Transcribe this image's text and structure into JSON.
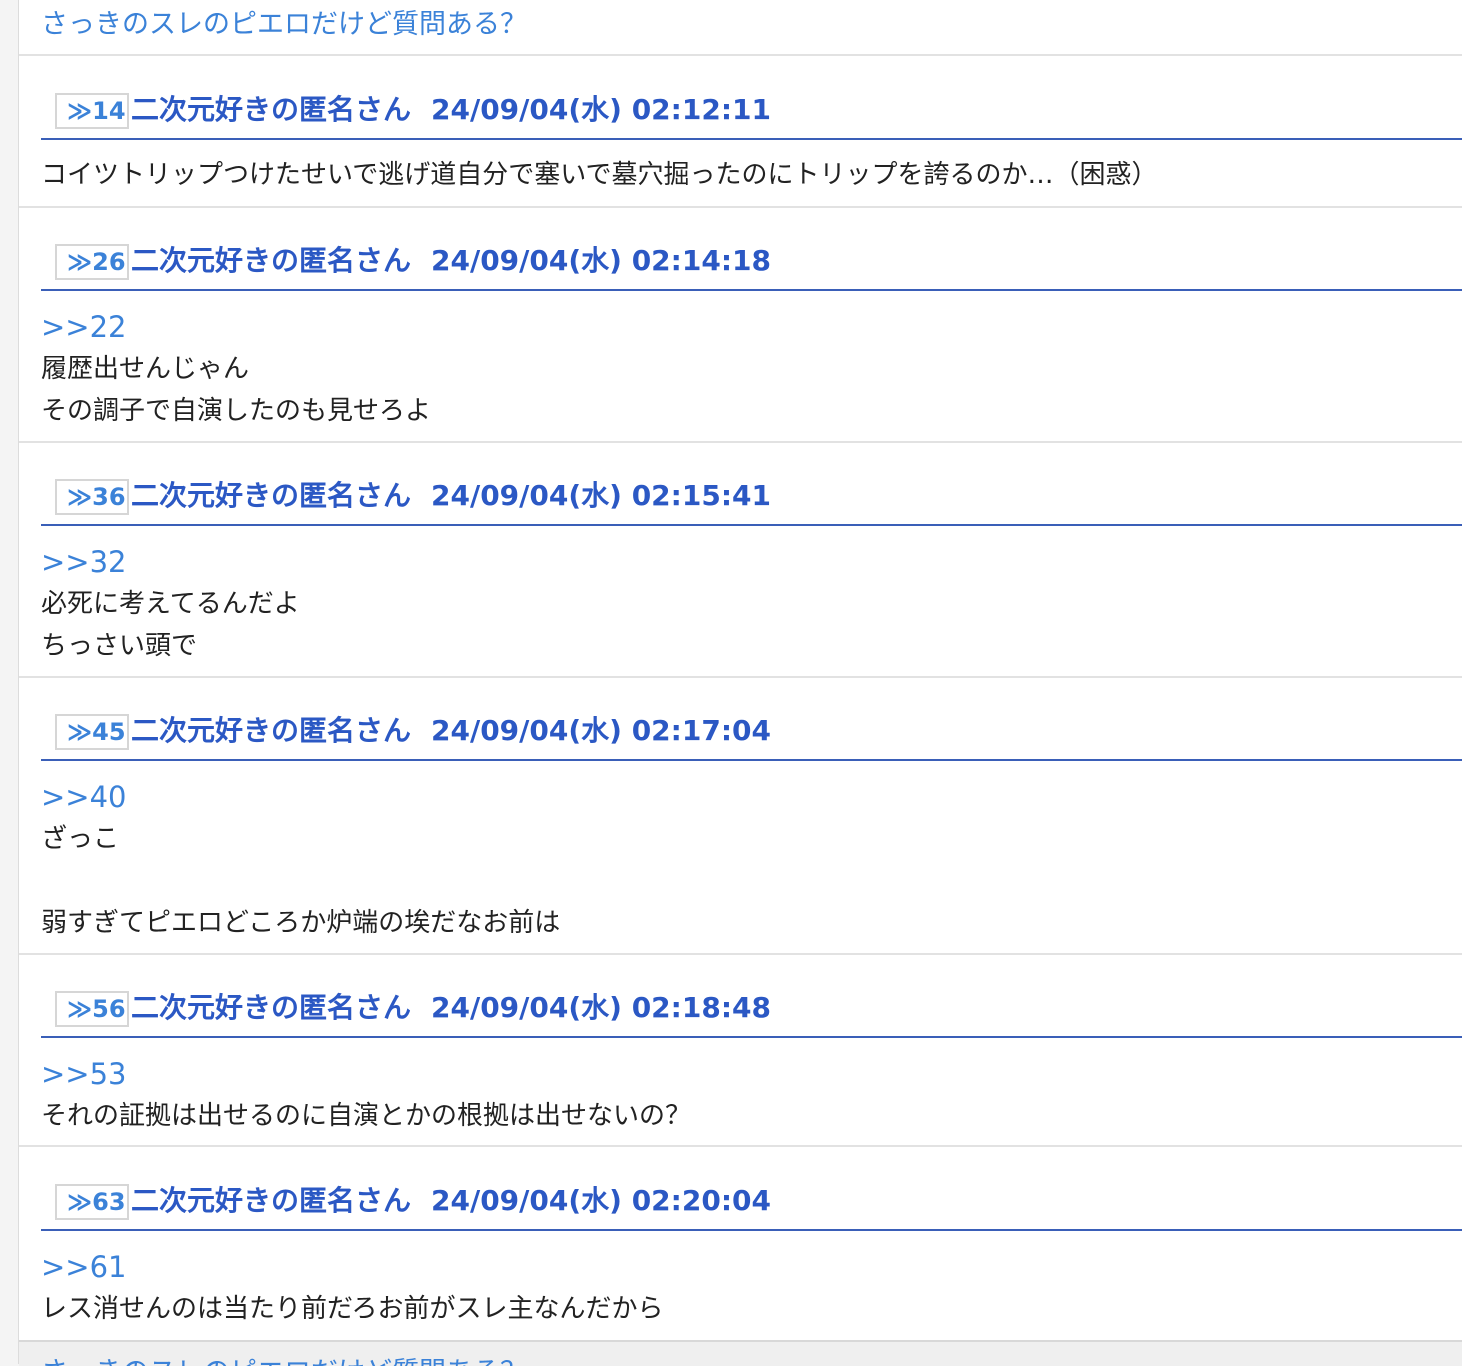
{
  "thread_title_top": "さっきのスレのピエロだけど質問ある？",
  "posts": [
    {
      "res_no": "≫14",
      "name": "二次元好きの匿名さん",
      "date": "24/09/04(水) 02:12:11",
      "anchor": "",
      "lines": [
        "コイツトリップつけたせいで逃げ道自分で塞いで墓穴掘ったのにトリップを誇るのか…（困惑）"
      ]
    },
    {
      "res_no": "≫26",
      "name": "二次元好きの匿名さん",
      "date": "24/09/04(水) 02:14:18",
      "anchor": ">>22",
      "lines": [
        "履歴出せんじゃん",
        "その調子で自演したのも見せろよ"
      ]
    },
    {
      "res_no": "≫36",
      "name": "二次元好きの匿名さん",
      "date": "24/09/04(水) 02:15:41",
      "anchor": ">>32",
      "lines": [
        "必死に考えてるんだよ",
        "ちっさい頭で"
      ]
    },
    {
      "res_no": "≫45",
      "name": "二次元好きの匿名さん",
      "date": "24/09/04(水) 02:17:04",
      "anchor": ">>40",
      "lines": [
        "ざっこ",
        "",
        "弱すぎてピエロどころか炉端の埃だなお前は"
      ]
    },
    {
      "res_no": "≫56",
      "name": "二次元好きの匿名さん",
      "date": "24/09/04(水) 02:18:48",
      "anchor": ">>53",
      "lines": [
        "それの証拠は出せるのに自演とかの根拠は出せないの？"
      ]
    },
    {
      "res_no": "≫63",
      "name": "二次元好きの匿名さん",
      "date": "24/09/04(水) 02:20:04",
      "anchor": ">>61",
      "lines": [
        "レス消せんのは当たり前だろお前がスレ主なんだから"
      ]
    }
  ],
  "next_thread_title": "さっきのスレのピエロだけど質問ある？"
}
